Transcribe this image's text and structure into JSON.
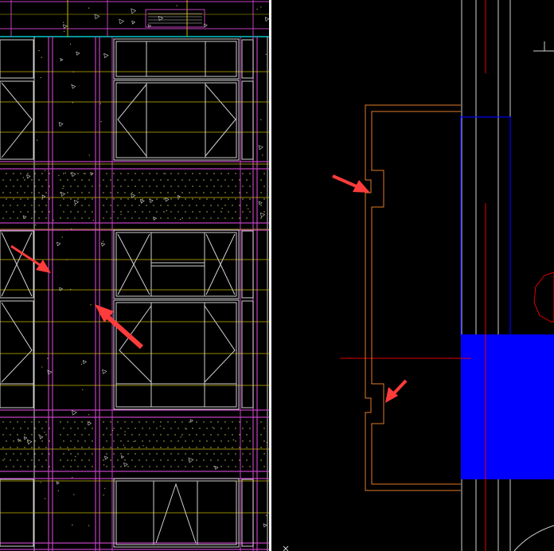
{
  "colors": {
    "background": "#000000",
    "divider": "#ffffff",
    "magenta": "#c040c0",
    "yellow": "#c8b400",
    "white_line": "#d0d0d0",
    "cyan": "#00c8c8",
    "dots": "#c8c85a",
    "orange": "#e07a28",
    "blue": "#0000ff",
    "red": "#e00000",
    "arrow": "#ff3c3c"
  },
  "left_panel": {
    "label": "cad-elevation-view",
    "elements": [
      "facade-grid",
      "window-frames",
      "hatched-panels",
      "stone-texture",
      "annotation-arrows"
    ],
    "arrow_count": 2
  },
  "right_panel": {
    "label": "cad-section-detail",
    "elements": [
      "notched-profile",
      "blue-column-outline",
      "blue-filled-block",
      "red-axis-lines",
      "red-octagon"
    ],
    "arrow_count": 2
  }
}
